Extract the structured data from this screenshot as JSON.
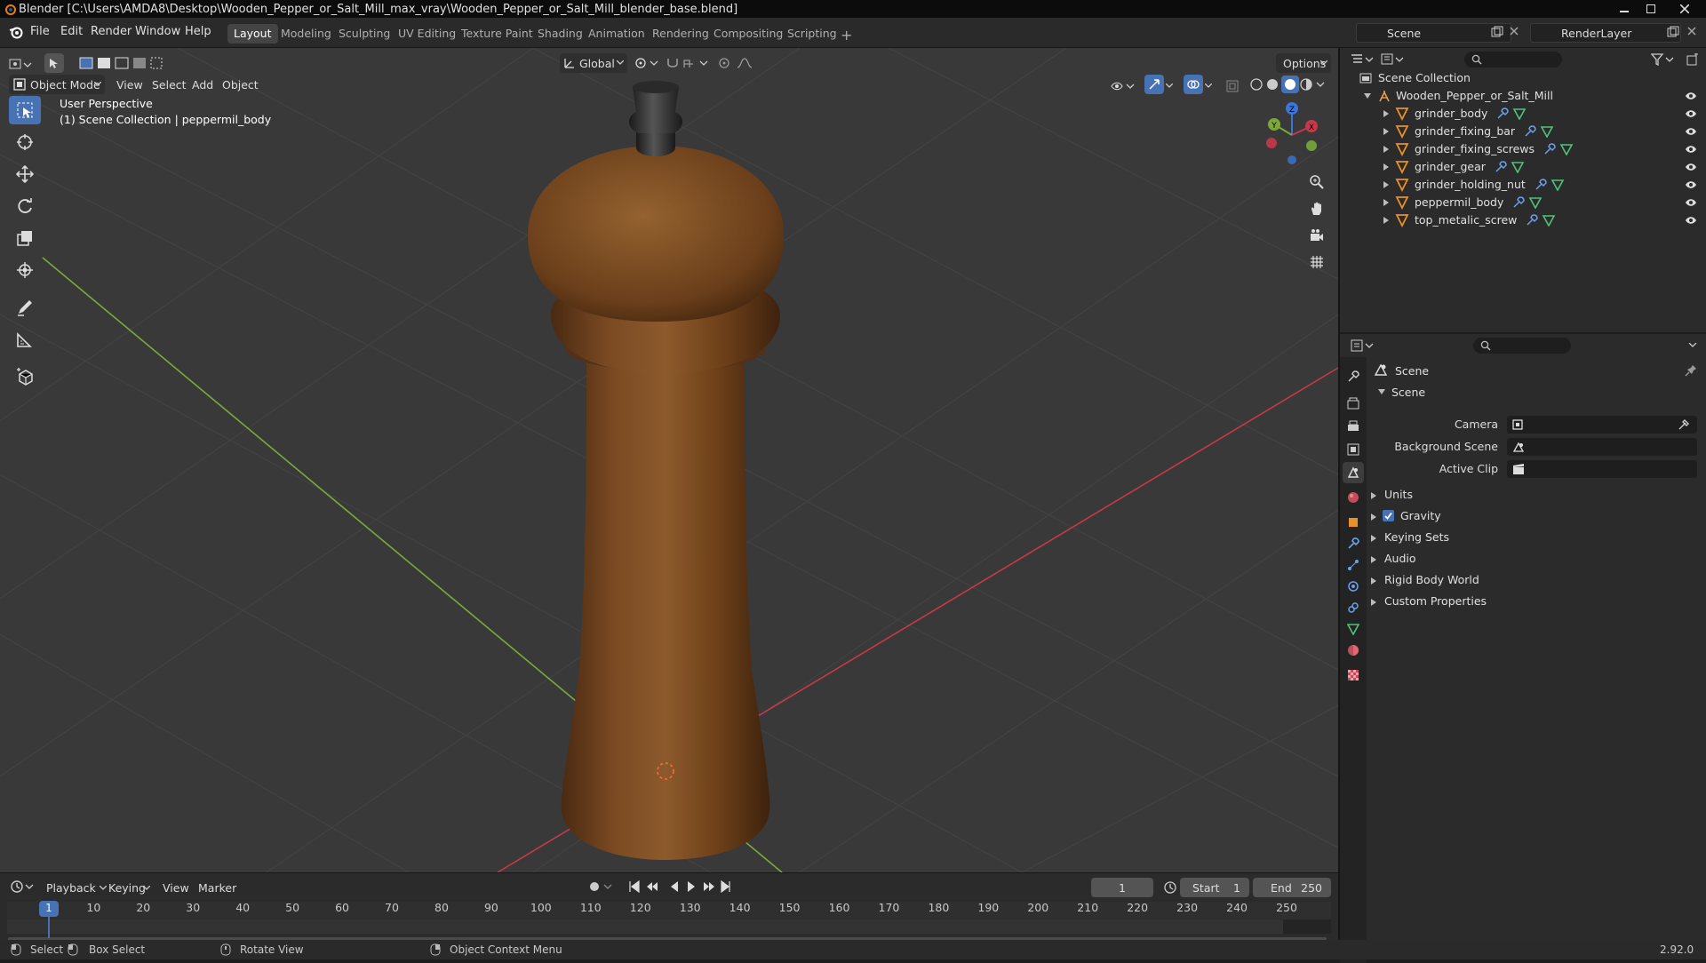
{
  "titlebar": {
    "title": "Blender [C:\\Users\\AMDA8\\Desktop\\Wooden_Pepper_or_Salt_Mill_max_vray\\Wooden_Pepper_or_Salt_Mill_blender_base.blend]"
  },
  "menu": {
    "file": "File",
    "edit": "Edit",
    "render": "Render",
    "window": "Window",
    "help": "Help"
  },
  "workspaces": [
    "Layout",
    "Modeling",
    "Sculpting",
    "UV Editing",
    "Texture Paint",
    "Shading",
    "Animation",
    "Rendering",
    "Compositing",
    "Scripting"
  ],
  "scene": {
    "name": "Scene",
    "render_layer": "RenderLayer"
  },
  "viewport": {
    "mode": "Object Mode",
    "menus": [
      "View",
      "Select",
      "Add",
      "Object"
    ],
    "transform_orientation": "Global",
    "options_label": "Options",
    "perspective_label": "User Perspective",
    "collection_info": "(1) Scene Collection | peppermil_body",
    "axis_x": "X",
    "axis_y": "Y",
    "axis_z": "Z",
    "colors": {
      "x_axis": "#c8384a",
      "y_axis": "#7aa83a",
      "z_axis": "#3c75d6",
      "active_tool": "#4772b3",
      "wood": "#7a4a22"
    }
  },
  "outliner": {
    "root": "Scene Collection",
    "collection": "Wooden_Pepper_or_Salt_Mill",
    "objects": [
      "grinder_body",
      "grinder_fixing_bar",
      "grinder_fixing_screws",
      "grinder_gear",
      "grinder_holding_nut",
      "peppermil_body",
      "top_metalic_screw"
    ]
  },
  "properties": {
    "header": "Scene",
    "panel_title": "Scene",
    "camera_label": "Camera",
    "background_scene_label": "Background Scene",
    "active_clip_label": "Active Clip",
    "subpanels": [
      "Units",
      "Gravity",
      "Keying Sets",
      "Audio",
      "Rigid Body World",
      "Custom Properties"
    ],
    "gravity_checked": true
  },
  "timeline": {
    "menus": [
      "Playback",
      "Keying",
      "View",
      "Marker"
    ],
    "current_frame": "1",
    "start_label": "Start",
    "start": "1",
    "end_label": "End",
    "end": "250",
    "ruler": [
      "1",
      "10",
      "20",
      "30",
      "40",
      "50",
      "60",
      "70",
      "80",
      "90",
      "100",
      "110",
      "120",
      "130",
      "140",
      "150",
      "160",
      "170",
      "180",
      "190",
      "200",
      "210",
      "220",
      "230",
      "240",
      "250"
    ]
  },
  "statusbar": {
    "select": "Select",
    "box_select": "Box Select",
    "rotate_view": "Rotate View",
    "context_menu": "Object Context Menu",
    "version": "2.92.0"
  }
}
